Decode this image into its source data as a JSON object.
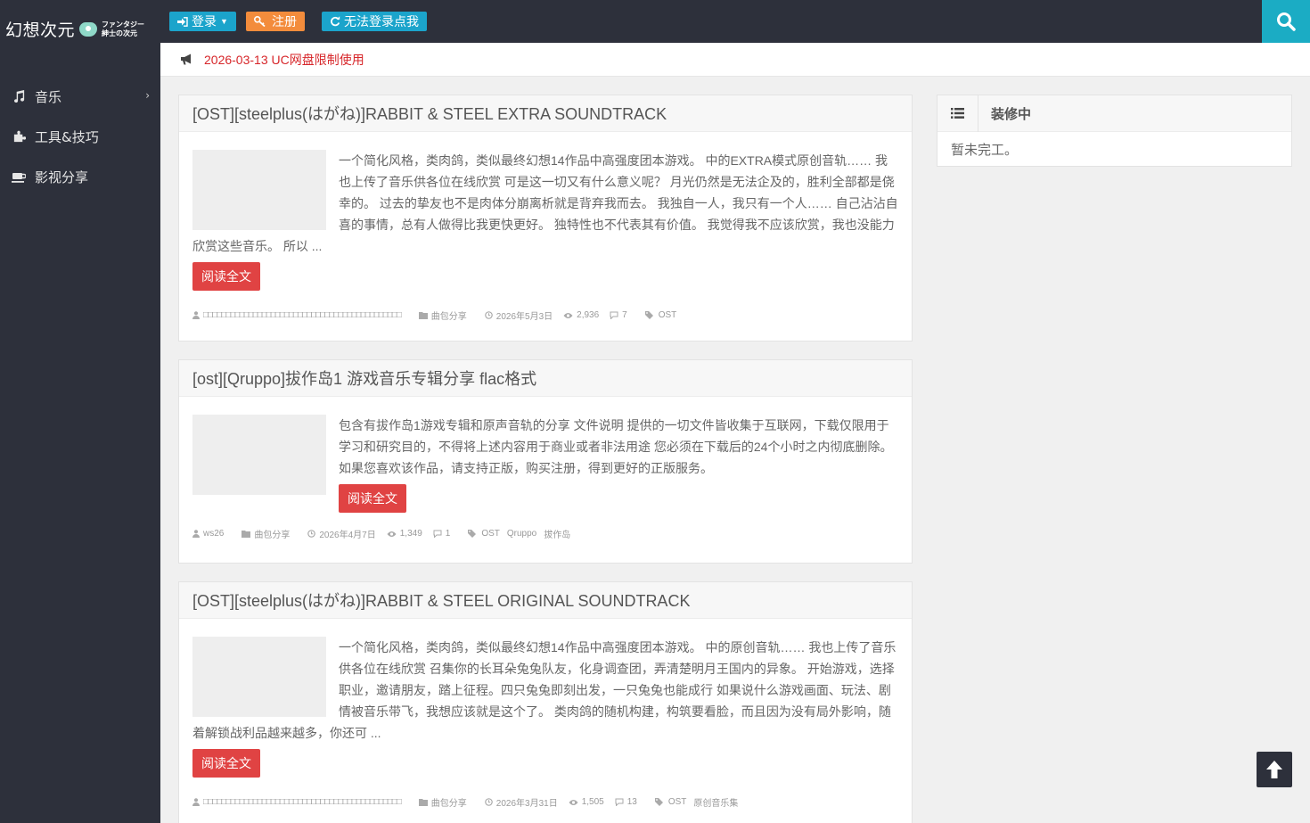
{
  "brand": {
    "name": "幻想次元",
    "sub_line1": "ファンタジー",
    "sub_line2": "紳士の次元"
  },
  "sidebar": {
    "items": [
      {
        "label": "音乐",
        "icon": "music-icon",
        "has_submenu": true
      },
      {
        "label": "工具&技巧",
        "icon": "puzzle-icon",
        "has_submenu": false
      },
      {
        "label": "影视分享",
        "icon": "coffee-icon",
        "has_submenu": false
      }
    ]
  },
  "topbar": {
    "login_label": "登录",
    "register_label": "注册",
    "help_label": "无法登录点我",
    "colors": {
      "primary": "#1ba4cb",
      "orange": "#f38c3c",
      "dark": "#2d303b"
    }
  },
  "notice": {
    "text": "2026-03-13 UC网盘限制使用"
  },
  "posts": [
    {
      "title": "[OST][steelplus(はがね)]RABBIT & STEEL EXTRA SOUNDTRACK",
      "excerpt": " 一个简化风格，类肉鸽，类似最终幻想14作品中高强度团本游戏。 中的EXTRA模式原创音轨…… 我也上传了音乐供各位在线欣赏 可是这一切又有什么意义呢？ 月光仍然是无法企及的，胜利全部都是侥幸的。 过去的挚友也不是肉体分崩离析就是背弃我而去。 我独自一人，我只有一个人…… 自己沾沾自喜的事情，总有人做得比我更快更好。 独特性也不代表其有价值。 我觉得我不应该欣赏，我也没能力欣赏这些音乐。 所以 ...",
      "read_more": "阅读全文",
      "author": "□□□□□□□□□□□□□□□□□□□□□□□□□□□□□□□□□□□□□□□□□□□□",
      "category": "曲包分享",
      "date": "2026年5月3日",
      "views": "2,936",
      "comments": "7",
      "tags": [
        "OST"
      ]
    },
    {
      "title": "[ost][Qruppo]拔作岛1 游戏音乐专辑分享 flac格式",
      "excerpt": "包含有拔作岛1游戏专辑和原声音轨的分享 文件说明 提供的一切文件皆收集于互联网，下载仅限用于学习和研究目的，不得将上述内容用于商业或者非法用途 您必须在下载后的24个小时之内彻底删除。 如果您喜欢该作品，请支持正版，购买注册，得到更好的正版服务。",
      "read_more": "阅读全文",
      "author": "ws26",
      "category": "曲包分享",
      "date": "2026年4月7日",
      "views": "1,349",
      "comments": "1",
      "tags": [
        "OST",
        "Qruppo",
        "拔作岛"
      ]
    },
    {
      "title": "[OST][steelplus(はがね)]RABBIT & STEEL ORIGINAL SOUNDTRACK",
      "excerpt": " 一个简化风格，类肉鸽，类似最终幻想14作品中高强度团本游戏。 中的原创音轨…… 我也上传了音乐供各位在线欣赏 召集你的长耳朵兔兔队友，化身调查团，弄清楚明月王国内的异象。 开始游戏，选择职业，邀请朋友，踏上征程。四只兔兔即刻出发，一只兔兔也能成行 如果说什么游戏画面、玩法、剧情被音乐带飞，我想应该就是这个了。 类肉鸽的随机构建，构筑要看脸，而且因为没有局外影响，随着解锁战利品越来越多，你还可 ...",
      "read_more": "阅读全文",
      "author": "□□□□□□□□□□□□□□□□□□□□□□□□□□□□□□□□□□□□□□□□□□□□",
      "category": "曲包分享",
      "date": "2026年3月31日",
      "views": "1,505",
      "comments": "13",
      "tags": [
        "OST",
        "原创音乐集"
      ]
    }
  ],
  "widget": {
    "title": "装修中",
    "body": "暂未完工。"
  },
  "colors": {
    "accent_red": "#e04343",
    "notice_red": "#d7262a",
    "search_teal": "#1bacc4"
  }
}
